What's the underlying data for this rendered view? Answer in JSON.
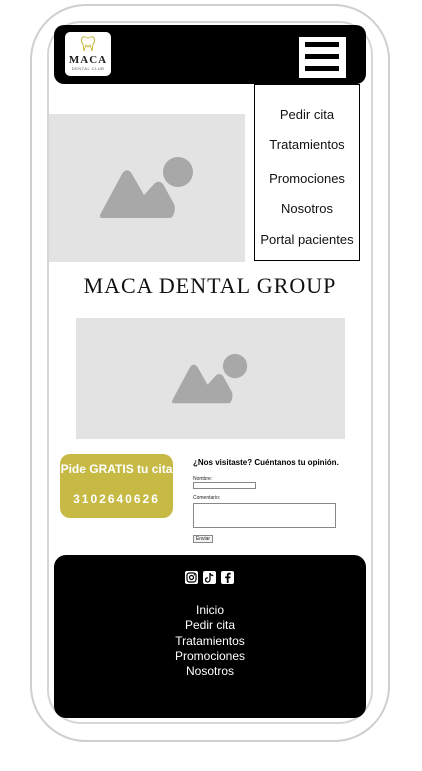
{
  "header": {
    "logo_text": "MACA",
    "logo_subtext": "DENTAL CLUB",
    "menu_icon": "hamburger-icon"
  },
  "nav_menu": {
    "items": [
      {
        "label": "Pedir cita"
      },
      {
        "label": "Tratamientos"
      },
      {
        "label": "Promociones"
      },
      {
        "label": "Nosotros"
      },
      {
        "label": "Portal pacientes"
      }
    ]
  },
  "images": {
    "hero_icon": "image-placeholder-icon",
    "secondary_icon": "image-placeholder-icon"
  },
  "brand": {
    "title": "MACA DENTAL GROUP"
  },
  "cta": {
    "title": "Pide GRATIS tu cita",
    "phone": "3102640626",
    "color": "#c6b944"
  },
  "feedback_form": {
    "title": "¿Nos visitaste? Cuéntanos tu opinión.",
    "name_label": "Nombre:",
    "comment_label": "Comentario:",
    "submit_label": "Enviar"
  },
  "footer": {
    "social_icons": [
      "instagram-icon",
      "tiktok-icon",
      "facebook-icon"
    ],
    "links": [
      {
        "label": "Inicio"
      },
      {
        "label": "Pedir cita"
      },
      {
        "label": "Tratamientos"
      },
      {
        "label": "Promociones"
      },
      {
        "label": "Nosotros"
      }
    ]
  }
}
